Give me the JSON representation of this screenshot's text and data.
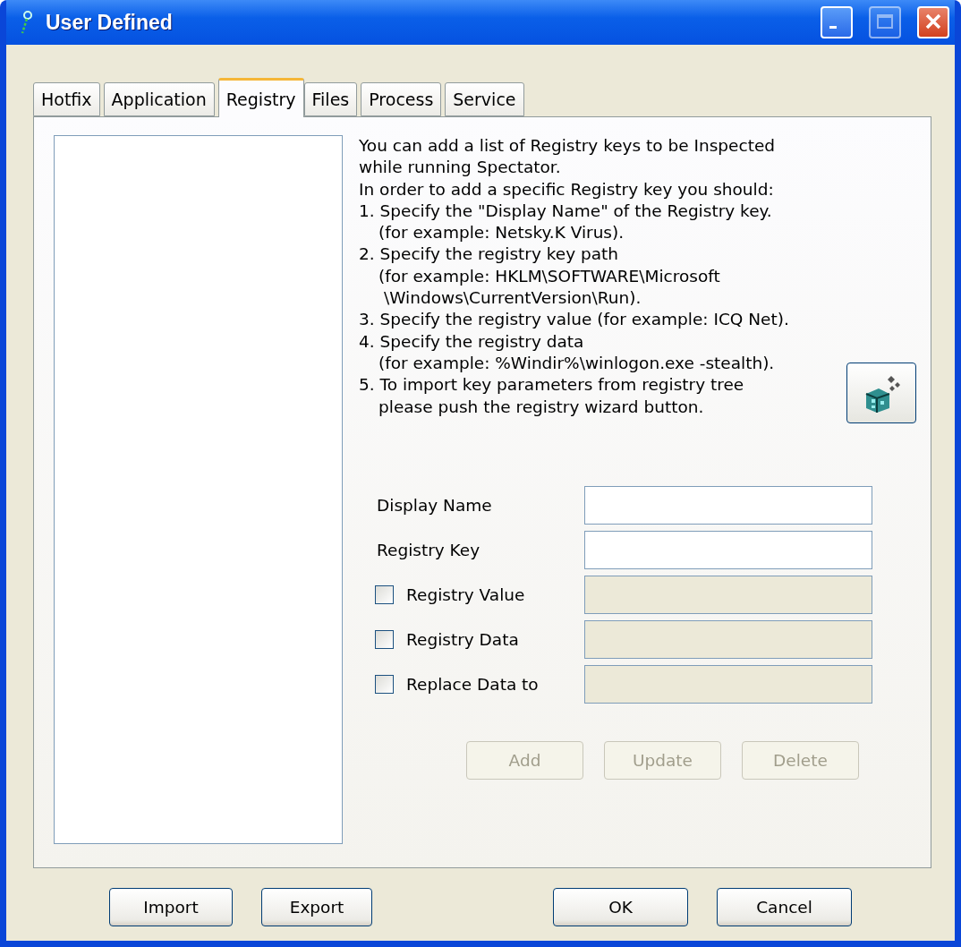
{
  "window": {
    "title": "User Defined",
    "controls": [
      {
        "kind": "minimize",
        "disabled": false
      },
      {
        "kind": "maximize",
        "disabled": true
      },
      {
        "kind": "close",
        "disabled": false
      }
    ]
  },
  "tabs": [
    {
      "label": "Hotfix",
      "selected": false
    },
    {
      "label": "Application",
      "selected": false
    },
    {
      "label": "Registry",
      "selected": true
    },
    {
      "label": "Files",
      "selected": false
    },
    {
      "label": "Process",
      "selected": false
    },
    {
      "label": "Service",
      "selected": false
    }
  ],
  "instructions": [
    {
      "kind": "line",
      "text": "You can add a list of Registry keys to be Inspected"
    },
    {
      "kind": "line",
      "text": "while running Spectator."
    },
    {
      "kind": "line",
      "text": "In order to add a specific Registry key you should:"
    },
    {
      "kind": "line",
      "text": "1. Specify the \"Display Name\" of the Registry key."
    },
    {
      "kind": "indent",
      "text": "(for example: Netsky.K Virus)."
    },
    {
      "kind": "line",
      "text": "2. Specify the registry key path"
    },
    {
      "kind": "indent",
      "text": "(for example: HKLM\\SOFTWARE\\Microsoft"
    },
    {
      "kind": "indent2",
      "text": "\\Windows\\CurrentVersion\\Run)."
    },
    {
      "kind": "line",
      "text": "3. Specify the registry value (for example: ICQ Net)."
    },
    {
      "kind": "line",
      "text": "4. Specify the registry data"
    },
    {
      "kind": "indent",
      "text": "(for example: %Windir%\\winlogon.exe -stealth)."
    },
    {
      "kind": "line",
      "text": "5. To import key parameters from registry tree"
    },
    {
      "kind": "indent",
      "text": "please push the registry wizard button."
    }
  ],
  "fields": [
    {
      "kind": "label",
      "label": "Display Name",
      "disabled": false
    },
    {
      "kind": "label",
      "label": "Registry Key",
      "disabled": false
    },
    {
      "kind": "checkbox",
      "label": "Registry Value",
      "checked": false,
      "disabled": true
    },
    {
      "kind": "checkbox",
      "label": "Registry Data",
      "checked": false,
      "disabled": true
    },
    {
      "kind": "checkbox",
      "label": "Replace Data to",
      "checked": false,
      "disabled": true
    }
  ],
  "actions": [
    {
      "label": "Add",
      "disabled": true
    },
    {
      "label": "Update",
      "disabled": true
    },
    {
      "label": "Delete",
      "disabled": true
    }
  ],
  "footer_left": [
    {
      "label": "Import"
    },
    {
      "label": "Export"
    }
  ],
  "footer_right": [
    {
      "label": "OK"
    },
    {
      "label": "Cancel"
    }
  ]
}
